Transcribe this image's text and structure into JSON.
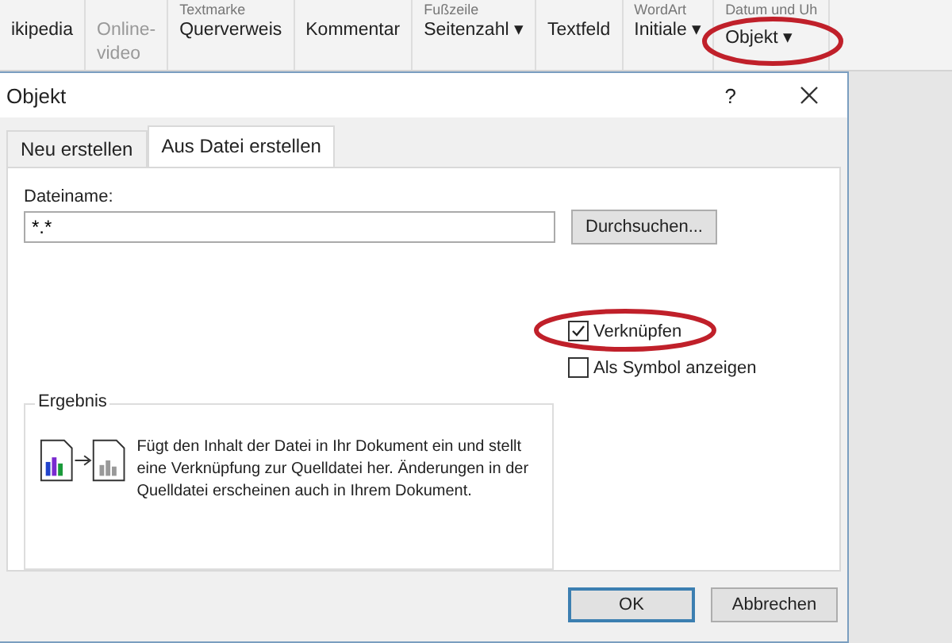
{
  "ribbon": {
    "groups": [
      {
        "items": [
          "ikipedia"
        ]
      },
      {
        "items": [
          "Online-",
          "video"
        ],
        "disabled": true
      },
      {
        "top": "Textmarke",
        "items": [
          "Querverweis"
        ]
      },
      {
        "items": [
          "Kommentar"
        ]
      },
      {
        "top": "Fußzeile",
        "items": [
          "Seitenzahl ▾"
        ]
      },
      {
        "items": [
          "Textfeld"
        ]
      },
      {
        "top": "WordArt",
        "items": [
          "Initiale ▾"
        ]
      },
      {
        "top": "Datum und Uh",
        "items": [
          "Objekt ▾"
        ],
        "circled": true
      }
    ]
  },
  "dialog": {
    "title": "Objekt",
    "help": "?",
    "tabs": [
      {
        "label": "Neu erstellen",
        "selected": false
      },
      {
        "label": "Aus Datei erstellen",
        "selected": true
      }
    ],
    "filename": {
      "label": "Dateiname:",
      "value": "*.*"
    },
    "browse": "Durchsuchen...",
    "checkboxes": [
      {
        "label": "Verknüpfen",
        "checked": true,
        "circled": true
      },
      {
        "label": "Als Symbol anzeigen",
        "checked": false,
        "circled": false
      }
    ],
    "result": {
      "title": "Ergebnis",
      "text": "Fügt den Inhalt der Datei in Ihr Dokument ein und stellt eine Verknüpfung zur Quelldatei her. Änderungen in der Quelldatei erscheinen auch in Ihrem Dokument."
    },
    "buttons": [
      {
        "label": "OK",
        "default": true
      },
      {
        "label": "Abbrechen",
        "default": false
      }
    ]
  }
}
